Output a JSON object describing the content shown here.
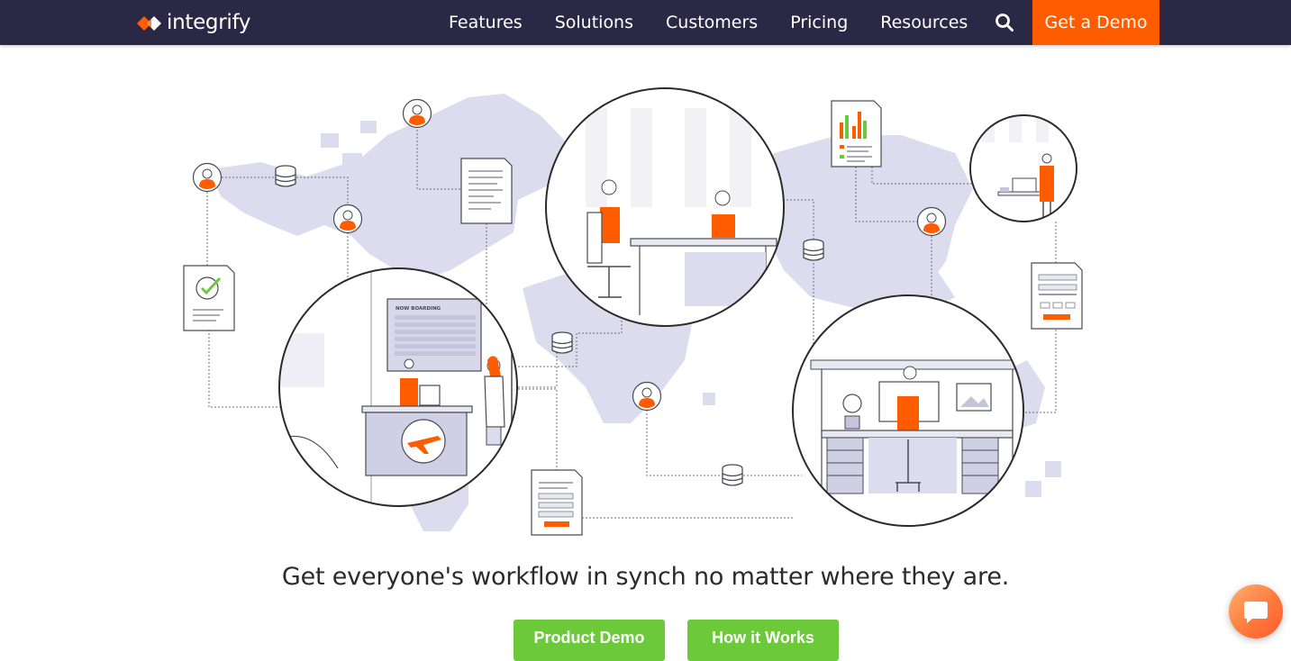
{
  "brand": {
    "name": "integrify",
    "accent": "#ff5c00",
    "nav_bg": "#2b2846",
    "cta_green": "#6cc93a"
  },
  "nav": {
    "items": [
      {
        "label": "Features"
      },
      {
        "label": "Solutions"
      },
      {
        "label": "Customers"
      },
      {
        "label": "Pricing"
      },
      {
        "label": "Resources"
      }
    ],
    "search_icon": "search-icon",
    "cta_label": "Get a Demo"
  },
  "illustration": {
    "boarding_sign": "NOW BOARDING"
  },
  "hero": {
    "tagline": "Get everyone's workflow in synch no matter where they are.",
    "buttons": [
      {
        "label": "Product Demo"
      },
      {
        "label": "How it Works"
      }
    ]
  },
  "chat": {
    "icon": "chat-bubble-icon"
  }
}
